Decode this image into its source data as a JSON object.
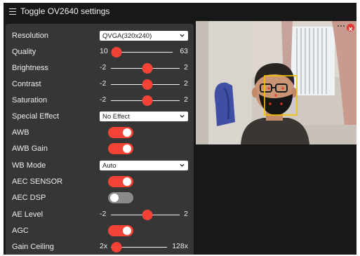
{
  "header": {
    "title": "Toggle OV2640 settings",
    "menu_icon": "hamburger-menu-icon"
  },
  "settings": {
    "resolution": {
      "label": "Resolution",
      "value": "QVGA(320x240)"
    },
    "quality": {
      "label": "Quality",
      "min": "10",
      "max": "63",
      "value": 10
    },
    "brightness": {
      "label": "Brightness",
      "min": "-2",
      "max": "2",
      "value": 0
    },
    "contrast": {
      "label": "Contrast",
      "min": "-2",
      "max": "2",
      "value": 0
    },
    "saturation": {
      "label": "Saturation",
      "min": "-2",
      "max": "2",
      "value": 0
    },
    "special_effect": {
      "label": "Special Effect",
      "value": "No Effect"
    },
    "awb": {
      "label": "AWB",
      "on": true
    },
    "awb_gain": {
      "label": "AWB Gain",
      "on": true
    },
    "wb_mode": {
      "label": "WB Mode",
      "value": "Auto"
    },
    "aec_sensor": {
      "label": "AEC SENSOR",
      "on": true
    },
    "aec_dsp": {
      "label": "AEC DSP",
      "on": false
    },
    "ae_level": {
      "label": "AE Level",
      "min": "-2",
      "max": "2",
      "value": 0
    },
    "agc": {
      "label": "AGC",
      "on": true
    },
    "gain_ceiling": {
      "label": "Gain Ceiling",
      "min": "2x",
      "max": "128x",
      "value": 0
    }
  },
  "stream": {
    "close_icon": "close-icon",
    "colors": {
      "accent": "#f44336",
      "face_box": "#f2c200"
    }
  }
}
